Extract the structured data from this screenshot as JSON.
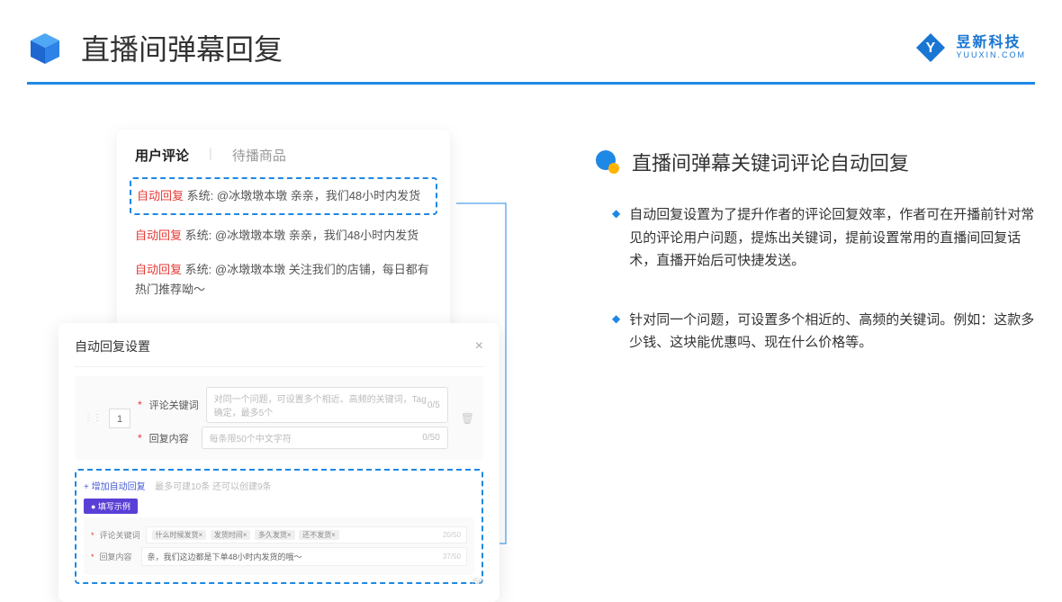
{
  "header": {
    "title": "直播间弹幕回复",
    "brand_cn": "昱新科技",
    "brand_en": "YUUXIN.COM"
  },
  "tabs": {
    "active": "用户评论",
    "inactive": "待播商品"
  },
  "comments": [
    {
      "badge": "自动回复",
      "sys": "系统:",
      "text": "@冰墩墩本墩 亲亲，我们48小时内发货"
    },
    {
      "badge": "自动回复",
      "sys": "系统:",
      "text": "@冰墩墩本墩 亲亲，我们48小时内发货"
    },
    {
      "badge": "自动回复",
      "sys": "系统:",
      "text": "@冰墩墩本墩 关注我们的店铺，每日都有热门推荐呦～"
    }
  ],
  "settings": {
    "title": "自动回复设置",
    "index": "1",
    "kw_label": "评论关键词",
    "kw_placeholder": "对同一个问题，可设置多个相近、高频的关键词，Tag确定，最多5个",
    "kw_counter": "0/5",
    "content_label": "回复内容",
    "content_placeholder": "每条限50个中文字符",
    "content_counter": "0/50",
    "add_link": "+ 增加自动回复",
    "add_hint": "最多可建10条 还可以创建9条",
    "example_label": "● 填写示例",
    "ex_kw_label": "评论关键词",
    "ex_tags": [
      "什么时候发货×",
      "发货时间×",
      "多久发货×",
      "还不发货×"
    ],
    "ex_kw_counter": "20/50",
    "ex_content_label": "回复内容",
    "ex_content_value": "亲，我们这边都是下单48小时内发货的哦～",
    "ex_content_counter": "37/50",
    "stray_counter": "/50"
  },
  "right": {
    "section_title": "直播间弹幕关键词评论自动回复",
    "bullets": [
      "自动回复设置为了提升作者的评论回复效率，作者可在开播前针对常见的评论用户问题，提炼出关键词，提前设置常用的直播间回复话术，直播开始后可快捷发送。",
      "针对同一个问题，可设置多个相近的、高频的关键词。例如：这款多少钱、这块能优惠吗、现在什么价格等。"
    ]
  }
}
